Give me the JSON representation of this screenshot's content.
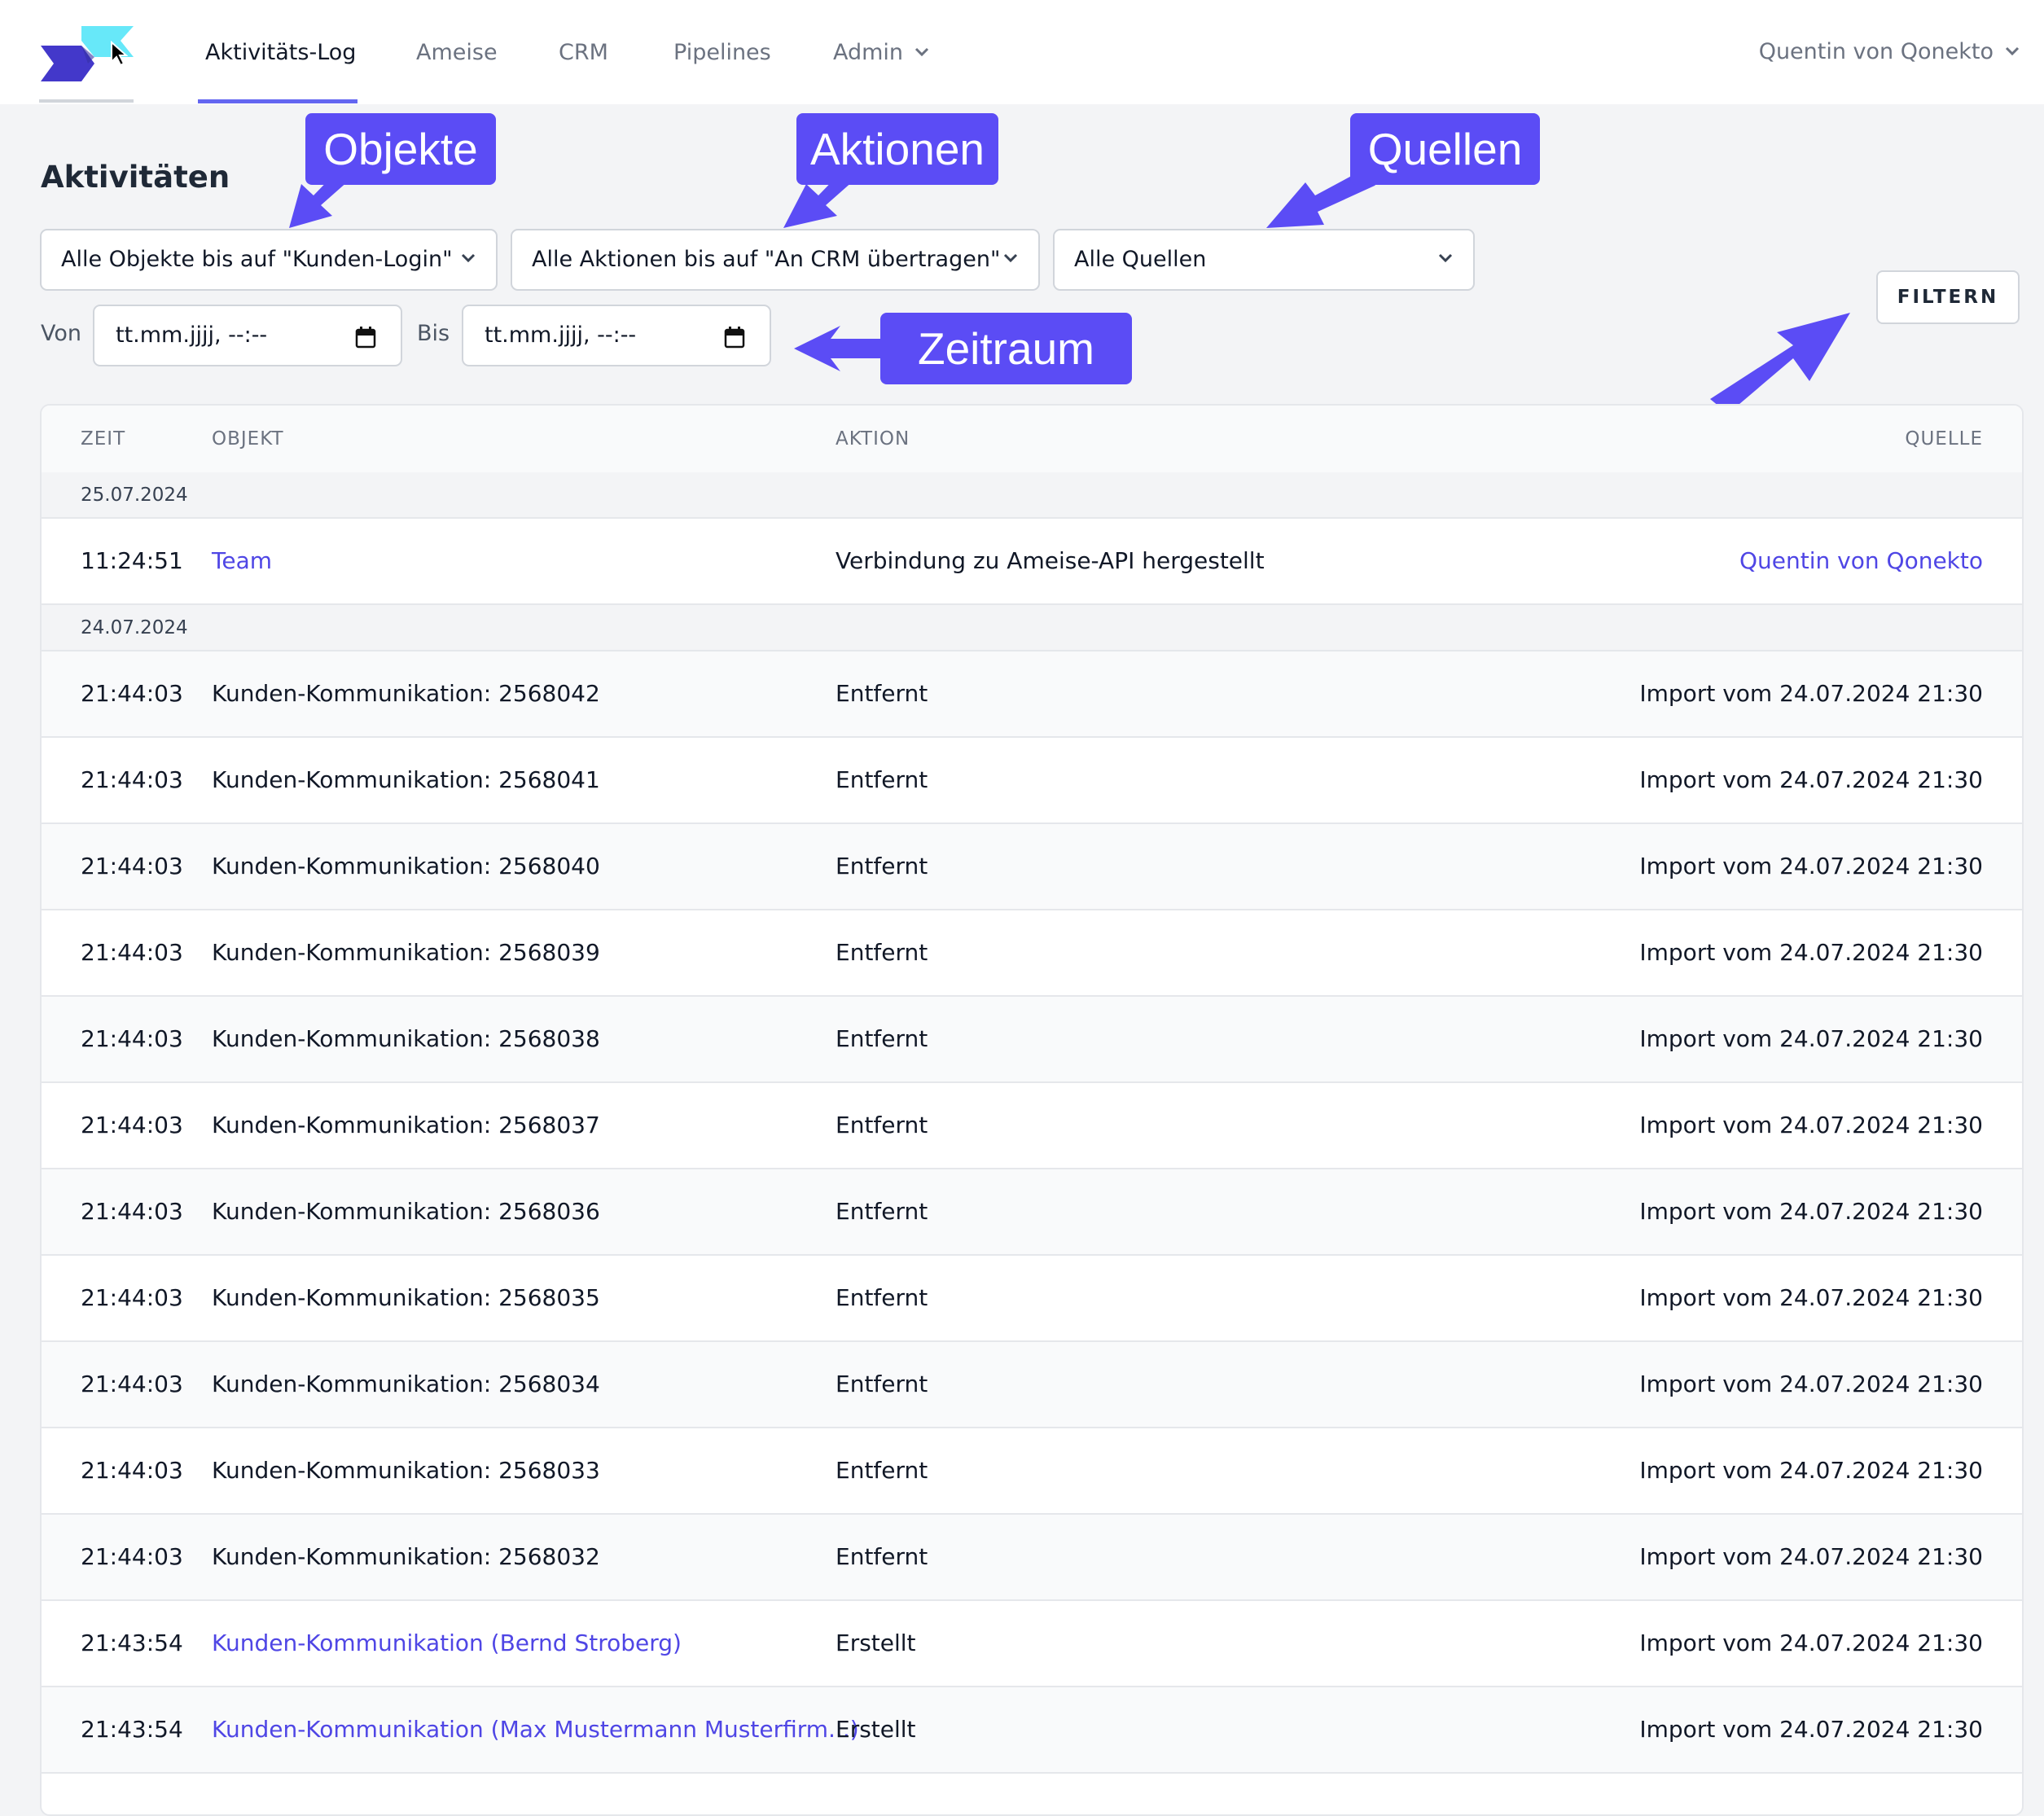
{
  "nav": {
    "items": [
      {
        "label": "Aktivitäts-Log",
        "active": true
      },
      {
        "label": "Ameise"
      },
      {
        "label": "CRM"
      },
      {
        "label": "Pipelines"
      },
      {
        "label": "Admin"
      }
    ],
    "user": "Quentin von Qonekto"
  },
  "page": {
    "title": "Aktivitäten"
  },
  "filters": {
    "objects": "Alle Objekte bis auf \"Kunden-Login\"",
    "actions": "Alle Aktionen bis auf \"An CRM übertragen\"",
    "sources": "Alle Quellen",
    "from_label": "Von",
    "to_label": "Bis",
    "from_value": "tt.mm.jjjj, --:--",
    "to_value": "tt.mm.jjjj, --:--",
    "filter_button": "FILTERN"
  },
  "annotations": {
    "objects": "Objekte",
    "actions": "Aktionen",
    "sources": "Quellen",
    "timerange": "Zeitraum"
  },
  "table": {
    "headers": {
      "time": "ZEIT",
      "object": "OBJEKT",
      "action": "AKTION",
      "source": "QUELLE"
    },
    "groups": [
      {
        "date": "25.07.2024",
        "rows": [
          {
            "time": "11:24:51",
            "object": "Team",
            "object_link": true,
            "action": "Verbindung zu Ameise-API hergestellt",
            "source": "Quentin von Qonekto",
            "source_link": true
          }
        ]
      },
      {
        "date": "24.07.2024",
        "rows": [
          {
            "time": "21:44:03",
            "object": "Kunden-Kommunikation: 2568042",
            "action": "Entfernt",
            "source": "Import vom 24.07.2024 21:30"
          },
          {
            "time": "21:44:03",
            "object": "Kunden-Kommunikation: 2568041",
            "action": "Entfernt",
            "source": "Import vom 24.07.2024 21:30"
          },
          {
            "time": "21:44:03",
            "object": "Kunden-Kommunikation: 2568040",
            "action": "Entfernt",
            "source": "Import vom 24.07.2024 21:30"
          },
          {
            "time": "21:44:03",
            "object": "Kunden-Kommunikation: 2568039",
            "action": "Entfernt",
            "source": "Import vom 24.07.2024 21:30"
          },
          {
            "time": "21:44:03",
            "object": "Kunden-Kommunikation: 2568038",
            "action": "Entfernt",
            "source": "Import vom 24.07.2024 21:30"
          },
          {
            "time": "21:44:03",
            "object": "Kunden-Kommunikation: 2568037",
            "action": "Entfernt",
            "source": "Import vom 24.07.2024 21:30"
          },
          {
            "time": "21:44:03",
            "object": "Kunden-Kommunikation: 2568036",
            "action": "Entfernt",
            "source": "Import vom 24.07.2024 21:30"
          },
          {
            "time": "21:44:03",
            "object": "Kunden-Kommunikation: 2568035",
            "action": "Entfernt",
            "source": "Import vom 24.07.2024 21:30"
          },
          {
            "time": "21:44:03",
            "object": "Kunden-Kommunikation: 2568034",
            "action": "Entfernt",
            "source": "Import vom 24.07.2024 21:30"
          },
          {
            "time": "21:44:03",
            "object": "Kunden-Kommunikation: 2568033",
            "action": "Entfernt",
            "source": "Import vom 24.07.2024 21:30"
          },
          {
            "time": "21:44:03",
            "object": "Kunden-Kommunikation: 2568032",
            "action": "Entfernt",
            "source": "Import vom 24.07.2024 21:30"
          },
          {
            "time": "21:43:54",
            "object": "Kunden-Kommunikation (Bernd Stroberg)",
            "object_link": true,
            "action": "Erstellt",
            "source": "Import vom 24.07.2024 21:30"
          },
          {
            "time": "21:43:54",
            "object": "Kunden-Kommunikation (Max Mustermann Musterfirm...)",
            "object_link": true,
            "action": "Erstellt",
            "source": "Import vom 24.07.2024 21:30"
          }
        ]
      }
    ]
  },
  "colors": {
    "accent": "#4f46e5",
    "annotation": "#5b4cf5",
    "logo_dark": "#4338ca",
    "logo_light": "#67e8f9"
  },
  "icons": [
    "logo-icon",
    "chevron-down-icon",
    "calendar-icon",
    "cursor-icon",
    "arrow-icon"
  ]
}
